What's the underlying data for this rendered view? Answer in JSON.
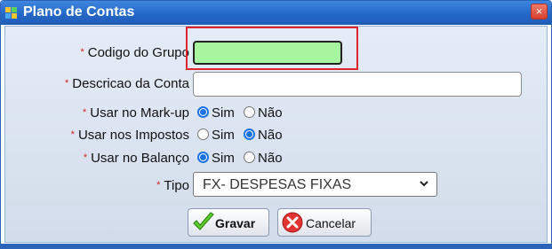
{
  "window": {
    "title": "Plano de Contas",
    "close_glyph": "×"
  },
  "form": {
    "required_mark": "*",
    "codigo_label": "Codigo do Grupo",
    "codigo_value": "",
    "descricao_label": "Descricao da Conta",
    "descricao_value": "",
    "markup_label": "Usar no Mark-up",
    "impostos_label": "Usar nos Impostos",
    "balanco_label": "Usar no Balanço",
    "opt_sim": "Sim",
    "opt_nao": "Não",
    "markup_selected": "Sim",
    "impostos_selected": "Não",
    "balanco_selected": "Sim",
    "tipo_label": "Tipo",
    "tipo_value": "FX- DESPESAS FIXAS"
  },
  "buttons": {
    "save_label": "Gravar",
    "cancel_label": "Cancelar"
  },
  "icons": {
    "app": "grid-app-icon",
    "save": "checkmark-icon",
    "cancel": "x-circle-icon"
  },
  "colors": {
    "titlebar": "#2568c8",
    "highlight": "#e0242b",
    "input_focus": "#a8f5a0",
    "radio_checked": "#1a73e8"
  }
}
